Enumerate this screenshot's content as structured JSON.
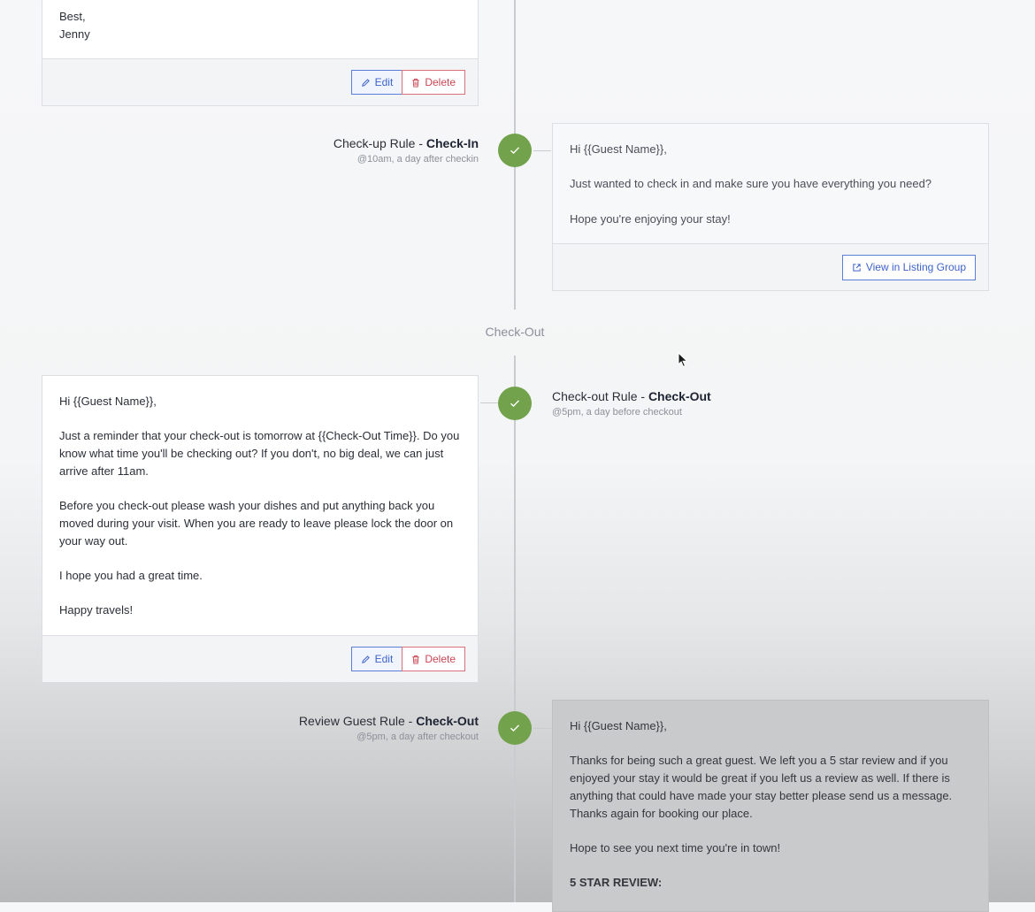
{
  "timeline": {
    "checkout_divider": "Check-Out"
  },
  "card_top": {
    "lines": [
      "Best,",
      "Jenny"
    ],
    "edit_label": "Edit",
    "delete_label": "Delete"
  },
  "rule_checkup": {
    "name": "Check-up Rule - ",
    "event": "Check-In",
    "schedule": "@10am, a day after checkin",
    "check_icon": "check-icon"
  },
  "card_checkup": {
    "paragraphs": [
      "Hi {{Guest Name}},",
      "Just wanted to check in and make sure you have everything you need?",
      "Hope you're enjoying your stay!"
    ],
    "view_label": "View in Listing Group"
  },
  "rule_checkout": {
    "name": "Check-out Rule - ",
    "event": "Check-Out",
    "schedule": "@5pm, a day before checkout",
    "check_icon": "check-icon"
  },
  "card_checkout": {
    "paragraphs": [
      "Hi {{Guest Name}},",
      "Just a reminder that your check-out is tomorrow at {{Check-Out Time}}. Do you know what time you'll be checking out?  If you don't, no big deal, we can just arrive after 11am.",
      "Before you check-out please wash your dishes and put anything back you moved during your visit.  When you are ready to leave please lock the door on your way out.",
      "I hope you had a great time.",
      "Happy travels!"
    ],
    "edit_label": "Edit",
    "delete_label": "Delete"
  },
  "rule_review": {
    "name": "Review Guest Rule - ",
    "event": "Check-Out",
    "schedule": "@5pm, a day after checkout",
    "check_icon": "check-icon"
  },
  "card_review": {
    "paragraphs": [
      "Hi {{Guest Name}},",
      "Thanks for being such a great guest.  We left you a 5 star review and if you enjoyed your stay it would be great if you left us a review as well.  If there is anything that could have made your stay better please send us a message.  Thanks again for booking our place.",
      "Hope to see you next time you're in town!"
    ],
    "heading": "5 STAR REVIEW:"
  },
  "colors": {
    "node_green": "#72a24c",
    "edit_blue": "#3d63c9",
    "delete_red": "#c84654"
  }
}
